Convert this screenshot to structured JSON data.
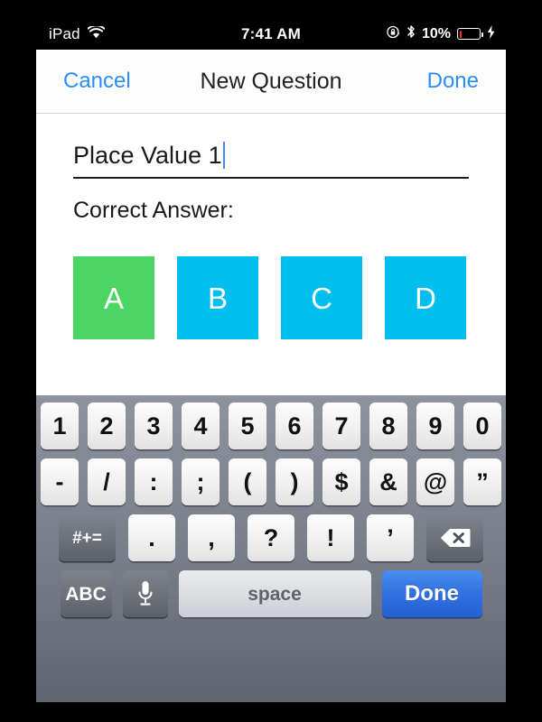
{
  "status_bar": {
    "device_name": "iPad",
    "wifi_icon": "wifi-icon",
    "time": "7:41 AM",
    "rotation_lock_icon": "rotation-lock-icon",
    "bluetooth_icon": "bluetooth-icon",
    "battery_percent": "10%",
    "battery_icon": "battery-icon",
    "charging_icon": "lightning-bolt-icon",
    "battery_level_color": "#ff2d22"
  },
  "navbar": {
    "cancel_label": "Cancel",
    "title": "New Question",
    "done_label": "Done",
    "tint_color": "#2b8ef7"
  },
  "form": {
    "question_title_value": "Place Value 1",
    "question_title_placeholder": "Question Title",
    "correct_answer_label": "Correct Answer:",
    "answers": [
      {
        "label": "A",
        "selected": true,
        "color": "#4cd464"
      },
      {
        "label": "B",
        "selected": false,
        "color": "#00bfef"
      },
      {
        "label": "C",
        "selected": false,
        "color": "#00bfef"
      },
      {
        "label": "D",
        "selected": false,
        "color": "#00bfef"
      }
    ]
  },
  "keyboard": {
    "type": "numeric-symbols",
    "row1": [
      "1",
      "2",
      "3",
      "4",
      "5",
      "6",
      "7",
      "8",
      "9",
      "0"
    ],
    "row2": [
      "-",
      "/",
      ":",
      ";",
      "(",
      ")",
      "$",
      "&",
      "@",
      "”"
    ],
    "row3": {
      "modifier_label": "#+=",
      "keys": [
        ".",
        ",",
        "?",
        "!",
        "’"
      ],
      "delete_icon": "delete-backspace-icon"
    },
    "row4": {
      "abc_label": "ABC",
      "mic_icon": "microphone-icon",
      "space_label": "space",
      "done_label": "Done",
      "done_color": "#2f6fe0"
    }
  }
}
